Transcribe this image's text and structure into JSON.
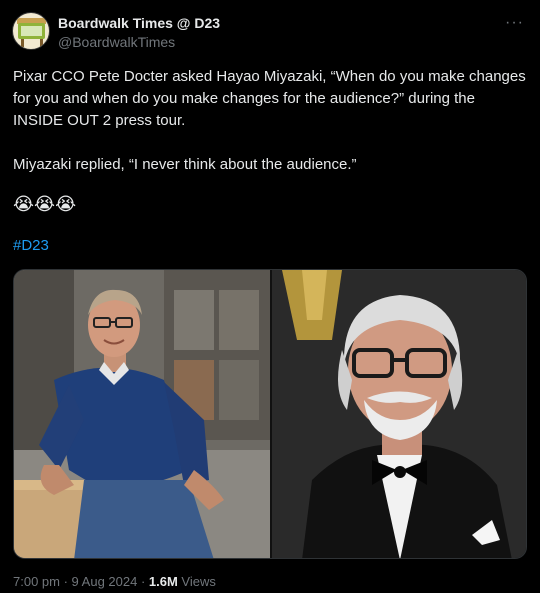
{
  "author": {
    "name": "Boardwalk Times @ D23",
    "handle": "@BoardwalkTimes"
  },
  "more_label": "···",
  "tweet": {
    "paragraph1": "Pixar CCO Pete Docter asked Hayao Miyazaki, “When do you make changes for you and when do you make changes for the audience?” during the INSIDE OUT 2 press tour.",
    "paragraph2": "Miyazaki replied, “I never think about the audience.”",
    "emojis": "😭😭😭",
    "hashtag": "#D23"
  },
  "footer": {
    "time": "7:00 pm",
    "sep1": " · ",
    "date": "9 Aug 2024",
    "sep2": " · ",
    "views_count": "1.6M",
    "views_label": " Views"
  },
  "colors": {
    "background": "#000000",
    "text": "#e7e9ea",
    "muted": "#71767b",
    "link": "#1d9bf0"
  }
}
